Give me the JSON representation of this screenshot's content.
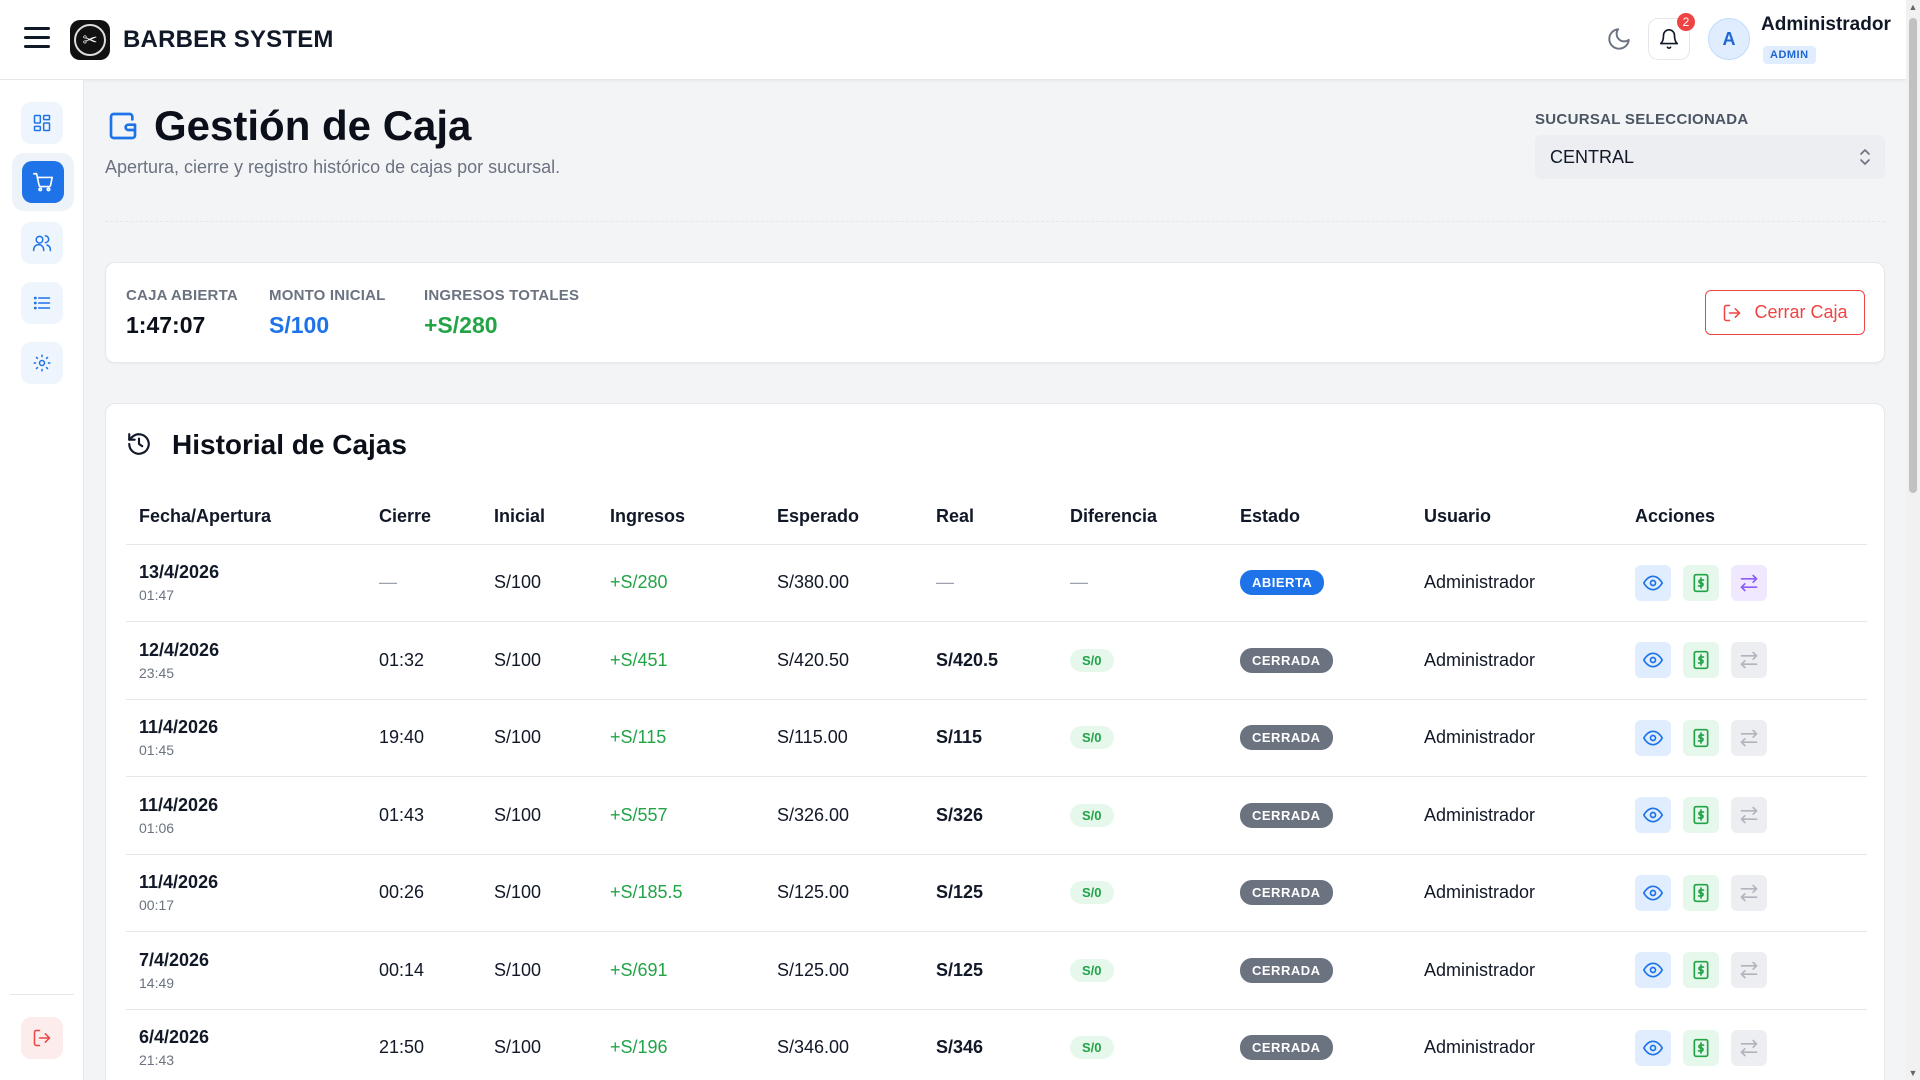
{
  "app": {
    "brand": "BARBER SYSTEM",
    "notifications_count": "2",
    "user_initial": "A",
    "user_name": "Administrador",
    "user_role": "ADMIN"
  },
  "sidebar": {
    "items": [
      {
        "name": "dashboard",
        "icon": "grid-icon"
      },
      {
        "name": "cash",
        "icon": "cart-icon"
      },
      {
        "name": "users",
        "icon": "users-icon"
      },
      {
        "name": "list",
        "icon": "list-icon"
      },
      {
        "name": "settings",
        "icon": "gear-icon"
      }
    ],
    "logout_icon": "logout-icon"
  },
  "page": {
    "title": "Gestión de Caja",
    "subtitle": "Apertura, cierre y registro histórico de cajas por sucursal.",
    "branch_label": "SUCURSAL SELECCIONADA",
    "branch_value": "CENTRAL"
  },
  "summary": {
    "open_label": "CAJA ABIERTA",
    "open_value": "1:47:07",
    "initial_label": "MONTO INICIAL",
    "initial_value": "S/100",
    "income_label": "INGRESOS TOTALES",
    "income_value": "+S/280",
    "close_button": "Cerrar Caja"
  },
  "history": {
    "title": "Historial de Cajas",
    "columns": [
      "Fecha/Apertura",
      "Cierre",
      "Inicial",
      "Ingresos",
      "Esperado",
      "Real",
      "Diferencia",
      "Estado",
      "Usuario",
      "Acciones"
    ],
    "rows": [
      {
        "date": "13/4/2026",
        "time": "01:47",
        "close": "—",
        "initial": "S/100",
        "income": "+S/280",
        "expected": "S/380.00",
        "real": "—",
        "diff": "—",
        "state": "ABIERTA",
        "user": "Administrador"
      },
      {
        "date": "12/4/2026",
        "time": "23:45",
        "close": "01:32",
        "initial": "S/100",
        "income": "+S/451",
        "expected": "S/420.50",
        "real": "S/420.5",
        "diff": "S/0",
        "state": "CERRADA",
        "user": "Administrador"
      },
      {
        "date": "11/4/2026",
        "time": "01:45",
        "close": "19:40",
        "initial": "S/100",
        "income": "+S/115",
        "expected": "S/115.00",
        "real": "S/115",
        "diff": "S/0",
        "state": "CERRADA",
        "user": "Administrador"
      },
      {
        "date": "11/4/2026",
        "time": "01:06",
        "close": "01:43",
        "initial": "S/100",
        "income": "+S/557",
        "expected": "S/326.00",
        "real": "S/326",
        "diff": "S/0",
        "state": "CERRADA",
        "user": "Administrador"
      },
      {
        "date": "11/4/2026",
        "time": "00:17",
        "close": "00:26",
        "initial": "S/100",
        "income": "+S/185.5",
        "expected": "S/125.00",
        "real": "S/125",
        "diff": "S/0",
        "state": "CERRADA",
        "user": "Administrador"
      },
      {
        "date": "7/4/2026",
        "time": "14:49",
        "close": "00:14",
        "initial": "S/100",
        "income": "+S/691",
        "expected": "S/125.00",
        "real": "S/125",
        "diff": "S/0",
        "state": "CERRADA",
        "user": "Administrador"
      },
      {
        "date": "6/4/2026",
        "time": "21:43",
        "close": "21:50",
        "initial": "S/100",
        "income": "+S/196",
        "expected": "S/346.00",
        "real": "S/346",
        "diff": "S/0",
        "state": "CERRADA",
        "user": "Administrador"
      }
    ]
  },
  "colors": {
    "accent": "#1e73e8",
    "open_state": "#1e73e8",
    "closed_state": "#6b7280",
    "positive": "#22a447",
    "danger": "#ef4444"
  }
}
